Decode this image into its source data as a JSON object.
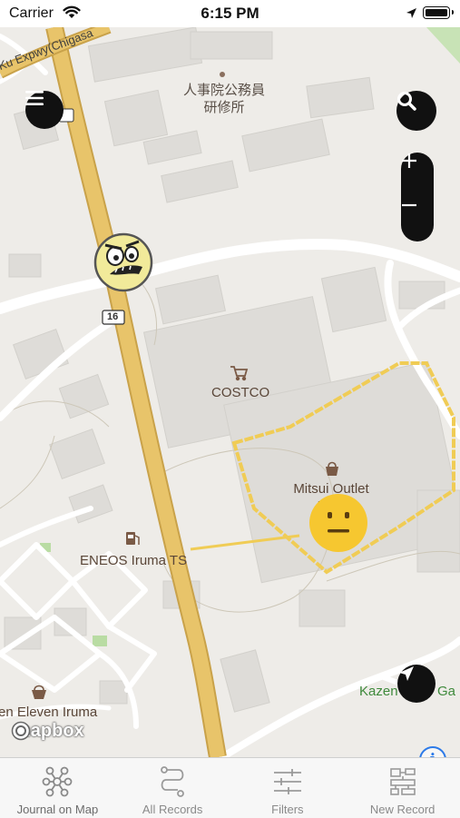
{
  "status_bar": {
    "carrier": "Carrier",
    "time": "6:15 PM"
  },
  "map": {
    "labels": {
      "expressway": "Ku Expwy(Chigasa",
      "gov_building": "人事院公務員\n研修所",
      "route_number": "16",
      "costco": "COSTCO",
      "outlet": "Mitsui Outlet\nPa        a",
      "eneos": "ENEOS Iruma TS",
      "seven_eleven": "en Eleven Iruma",
      "kazen": "Kazen",
      "kazen_right": "Ga",
      "mapbox": "mapbox"
    },
    "markers": [
      {
        "name": "annoyed-face-marker",
        "mood": "angry"
      },
      {
        "name": "neutral-face-marker",
        "mood": "neutral"
      }
    ],
    "colors": {
      "highway": "#e8c46a",
      "highway_edge": "#c9a24a",
      "road": "#ffffff",
      "building": "#dcdad6",
      "outlet_path": "#f0cc55"
    }
  },
  "controls": {
    "menu_icon": "hamburger-icon",
    "search_icon": "search-icon",
    "zoom_in": "+",
    "zoom_out": "−",
    "locate_icon": "navigation-arrow-icon",
    "info": "i"
  },
  "tabs": [
    {
      "label": "Journal on Map",
      "icon": "network-icon",
      "active": true
    },
    {
      "label": "All Records",
      "icon": "route-icon",
      "active": false
    },
    {
      "label": "Filters",
      "icon": "sliders-icon",
      "active": false
    },
    {
      "label": "New Record",
      "icon": "grid-record-icon",
      "active": false
    }
  ]
}
